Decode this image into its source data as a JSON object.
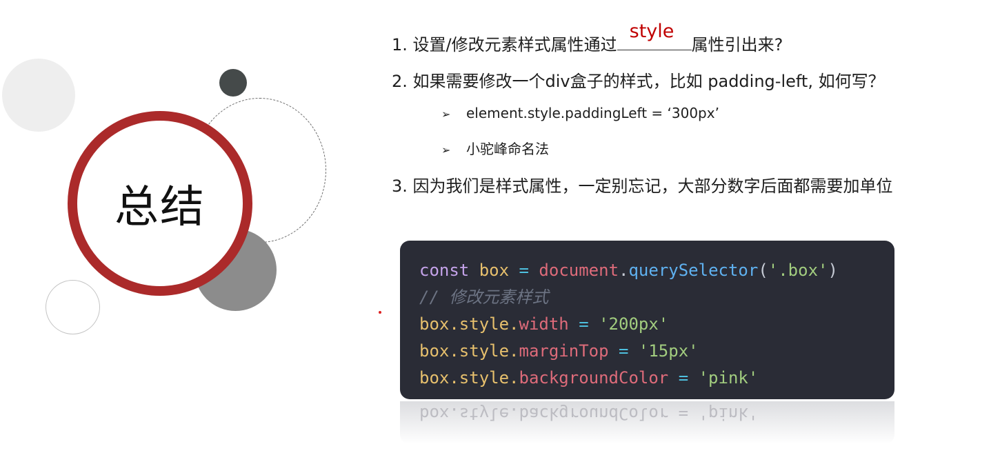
{
  "title": "总结",
  "questions": {
    "q1_prefix": "1. 设置/修改元素样式属性通过",
    "q1_answer": "style",
    "q1_suffix": "属性引出来?",
    "q2": "2. 如果需要修改一个div盒子的样式，比如 padding-left, 如何写？",
    "bullets": [
      "element.style.paddingLeft = ‘300px’",
      "小驼峰命名法"
    ],
    "q3": "3. 因为我们是样式属性，一定别忘记，大部分数字后面都需要加单位"
  },
  "bullet_icon": "arrow-bullet-icon",
  "code": {
    "l1": {
      "kw": "const",
      "var": "box",
      "op": " = ",
      "obj": "document",
      "dot": ".",
      "fn": "querySelector",
      "p1": "(",
      "str": "'.box'",
      "p2": ")"
    },
    "l2": {
      "comment": "// 修改元素样式"
    },
    "l3": {
      "obj": "box.style.",
      "prop": "width",
      "op": " = ",
      "str": "'200px'"
    },
    "l4": {
      "obj": "box.style.",
      "prop": "marginTop",
      "op": " = ",
      "str": "'15px'"
    },
    "l5": {
      "obj": "box.style.",
      "prop": "backgroundColor",
      "op": " = ",
      "str": "'pink'"
    }
  },
  "reflection": "box.style.backgroundColor = 'pink'",
  "colors": {
    "accent_red": "#ab2a2a",
    "answer_red": "#c00000",
    "code_bg": "#2a2c36"
  }
}
